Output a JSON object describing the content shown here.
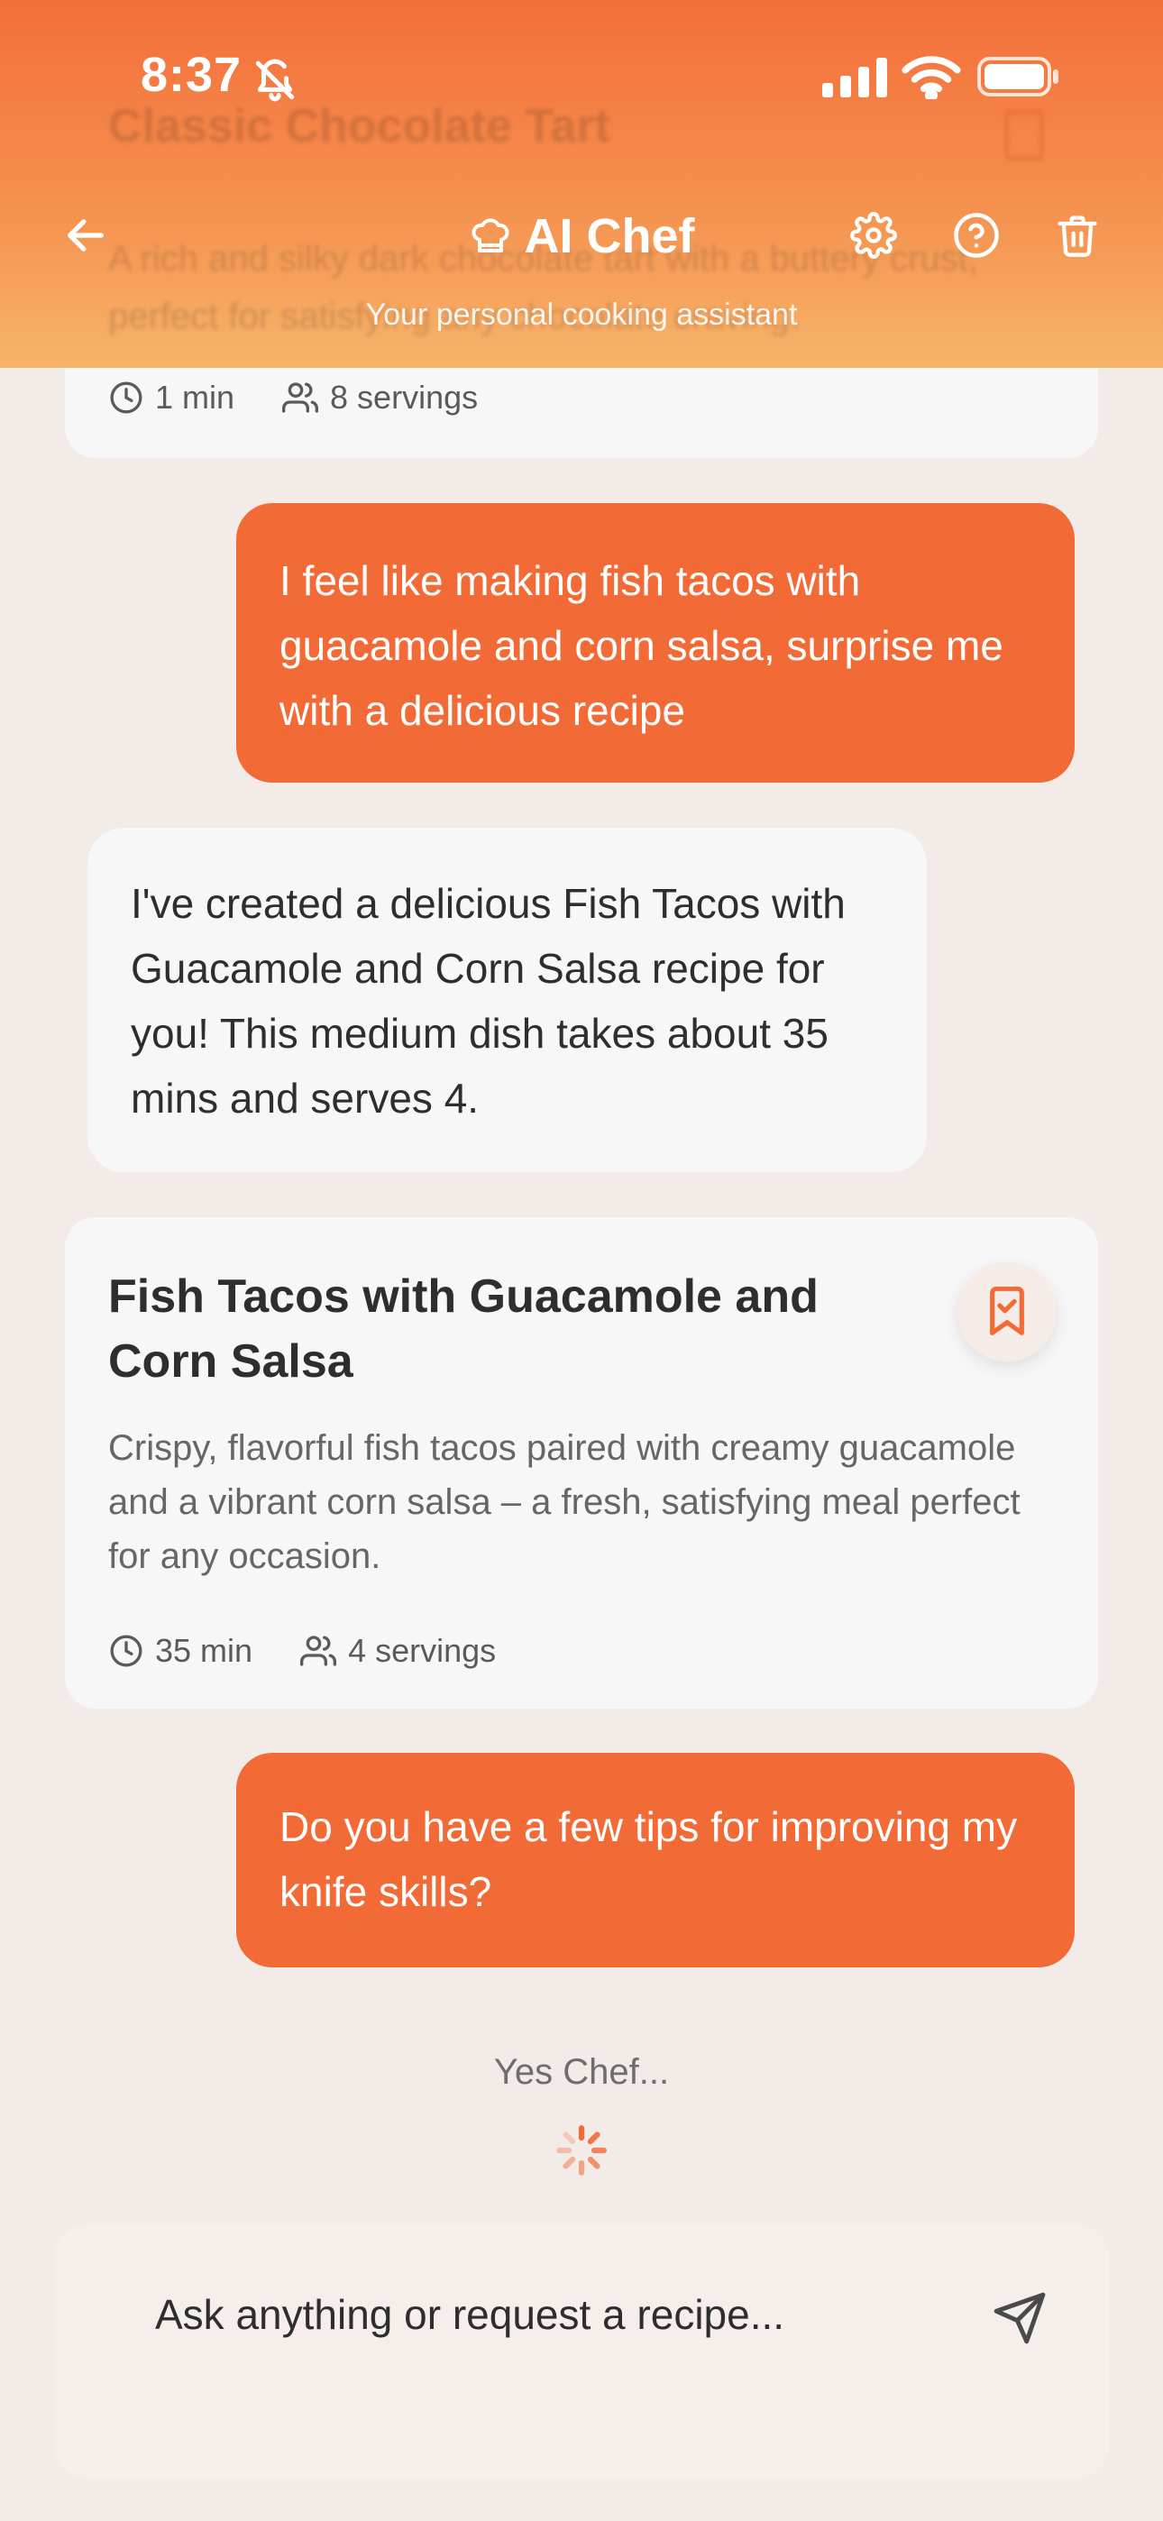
{
  "status_bar": {
    "time": "8:37"
  },
  "header": {
    "title": "AI Chef",
    "subtitle": "Your personal cooking assistant",
    "brand_color": "#f26a36",
    "icons": [
      "arrow-left-icon",
      "chef-hat-icon",
      "gear-icon",
      "help-circle-icon",
      "trash-icon"
    ]
  },
  "previous_recipe": {
    "title": "Classic Chocolate Tart",
    "description": "A rich and silky dark chocolate tart with a buttery crust, perfect for satisfying any chocolate craving.",
    "time": "1 min",
    "servings": "8 servings"
  },
  "messages": [
    {
      "role": "user",
      "text": "I feel like making fish tacos with guacamole and corn salsa, surprise me with a delicious recipe"
    },
    {
      "role": "assistant",
      "text": "I've created a delicious Fish Tacos with Guacamole and Corn Salsa recipe for you! This medium dish takes about 35 mins and serves 4."
    },
    {
      "role": "user",
      "text": "Do you have a few tips for improving my knife skills?"
    }
  ],
  "recipe": {
    "title": "Fish Tacos with Guacamole and Corn Salsa",
    "description": "Crispy, flavorful fish tacos paired with creamy guacamole and a vibrant corn salsa – a fresh, satisfying meal perfect for any occasion.",
    "time": "35 min",
    "servings": "4 servings",
    "bookmarked": true
  },
  "thinking_text": "Yes Chef...",
  "input": {
    "placeholder": "Ask anything or request a recipe..."
  }
}
